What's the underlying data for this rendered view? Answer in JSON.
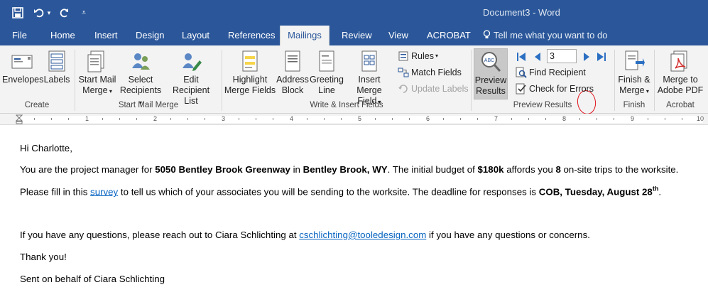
{
  "title_bar": {
    "doc_title": "Document3  -  Word",
    "qat": [
      "save-icon",
      "undo-icon",
      "redo-icon",
      "customize-icon"
    ]
  },
  "tabs": [
    "File",
    "Home",
    "Insert",
    "Design",
    "Layout",
    "References",
    "Mailings",
    "Review",
    "View",
    "ACROBAT"
  ],
  "active_tab": "Mailings",
  "tell_me": "Tell me what you want to do",
  "ribbon": {
    "create": {
      "label": "Create",
      "envelopes": "Envelopes",
      "labels": "Labels"
    },
    "start_mail_merge": {
      "label": "Start Mail Merge",
      "start_line1": "Start Mail",
      "start_line2": "Merge",
      "select_line1": "Select",
      "select_line2": "Recipients",
      "edit_line1": "Edit",
      "edit_line2": "Recipient List"
    },
    "write_insert": {
      "label": "Write & Insert Fields",
      "highlight_line1": "Highlight",
      "highlight_line2": "Merge Fields",
      "address_line1": "Address",
      "address_line2": "Block",
      "greeting_line1": "Greeting",
      "greeting_line2": "Line",
      "insert_line1": "Insert Merge",
      "insert_line2": "Field",
      "rules": "Rules",
      "match_fields": "Match Fields",
      "update_labels": "Update Labels"
    },
    "preview": {
      "label": "Preview Results",
      "preview_line1": "Preview",
      "preview_line2": "Results",
      "record_value": "3",
      "find_recipient": "Find Recipient",
      "check_errors": "Check for Errors"
    },
    "finish": {
      "label": "Finish",
      "line1": "Finish &",
      "line2": "Merge"
    },
    "acrobat": {
      "label": "Acrobat",
      "line1": "Merge to",
      "line2": "Adobe PDF"
    }
  },
  "ruler": {
    "numbers": [
      "1",
      "2",
      "3",
      "4",
      "5",
      "6",
      "7",
      "8",
      "9",
      "10"
    ]
  },
  "document": {
    "greeting": "Hi Charlotte,",
    "p1": {
      "t1": "You are the project manager for ",
      "b1": "5050 Bentley Brook Greenway",
      "t2": " in ",
      "b2": "Bentley Brook, WY",
      "t3": ".  The initial budget of ",
      "b3": "$180k",
      "t4": " affords you ",
      "b4": "8",
      "t5": " on-site trips to the worksite."
    },
    "p2": {
      "t1": "Please fill in this ",
      "link": "survey",
      "t2": " to tell us which of your associates you will be sending to the worksite.  The deadline for responses is ",
      "b1": "COB, Tuesday, August 28",
      "sup": "th",
      "t3": "."
    },
    "p3": {
      "t1": "If you have any questions, please reach out to Ciara Schlichting at ",
      "link": "cschlichting@tooledesign.com",
      "t2": " if you have any questions or concerns."
    },
    "thanks": "Thank you!",
    "signoff": "Sent on behalf of Ciara Schlichting"
  },
  "colors": {
    "word_blue": "#2b579a",
    "ribbon_bg": "#f3f3f3",
    "link": "#0563c1",
    "annotation_red": "#e0141b"
  }
}
